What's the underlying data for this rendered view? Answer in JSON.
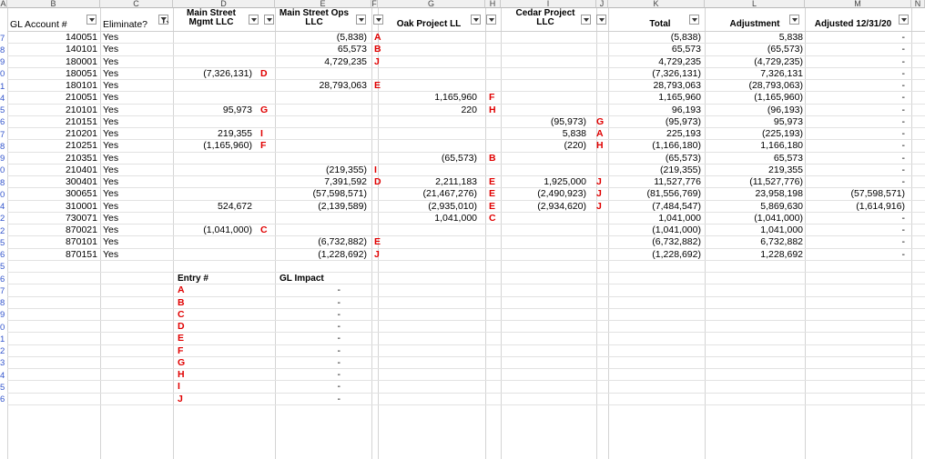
{
  "columns": [
    "A",
    "B",
    "C",
    "D",
    "E",
    "F",
    "G",
    "H",
    "I",
    "J",
    "K",
    "L",
    "M",
    "N"
  ],
  "row_numbers": [
    "7",
    "8",
    "9",
    "0",
    "1",
    "4",
    "5",
    "6",
    "7",
    "8",
    "9",
    "0",
    "8",
    "0",
    "4",
    "2",
    "2",
    "5",
    "6",
    "5",
    "6",
    "7",
    "8",
    "9",
    "0",
    "1",
    "2",
    "3",
    "4",
    "5",
    "6"
  ],
  "headers": {
    "gl_account": "GL Account #",
    "eliminate": "Eliminate?",
    "main_street_mgmt_1": "Main Street",
    "main_street_mgmt_2": "Mgmt LLC",
    "main_street_ops_1": "Main Street Ops",
    "main_street_ops_2": "LLC",
    "oak_project": "Oak Project LL",
    "cedar_project_1": "Cedar Project",
    "cedar_project_2": "LLC",
    "total": "Total",
    "adjustment": "Adjustment",
    "adjusted": "Adjusted 12/31/20"
  },
  "rows": [
    {
      "gl": "140051",
      "elim": "Yes",
      "c": "",
      "d": "",
      "e": "(5,838)",
      "f": "A",
      "g": "",
      "h": "",
      "i": "",
      "j": "",
      "total": "(5,838)",
      "adj": "5,838",
      "adjusted": "-"
    },
    {
      "gl": "140101",
      "elim": "Yes",
      "c": "",
      "d": "",
      "e": "65,573",
      "f": "B",
      "g": "",
      "h": "",
      "i": "",
      "j": "",
      "total": "65,573",
      "adj": "(65,573)",
      "adjusted": "-"
    },
    {
      "gl": "180001",
      "elim": "Yes",
      "c": "",
      "d": "",
      "e": "4,729,235",
      "f": "J",
      "g": "",
      "h": "",
      "i": "",
      "j": "",
      "total": "4,729,235",
      "adj": "(4,729,235)",
      "adjusted": "-"
    },
    {
      "gl": "180051",
      "elim": "Yes",
      "c": "(7,326,131)",
      "d": "D",
      "e": "",
      "f": "",
      "g": "",
      "h": "",
      "i": "",
      "j": "",
      "total": "(7,326,131)",
      "adj": "7,326,131",
      "adjusted": "-"
    },
    {
      "gl": "180101",
      "elim": "Yes",
      "c": "",
      "d": "",
      "e": "28,793,063",
      "f": "E",
      "g": "",
      "h": "",
      "i": "",
      "j": "",
      "total": "28,793,063",
      "adj": "(28,793,063)",
      "adjusted": "-"
    },
    {
      "gl": "210051",
      "elim": "Yes",
      "c": "",
      "d": "",
      "e": "",
      "f": "",
      "g": "1,165,960",
      "h": "F",
      "i": "",
      "j": "",
      "total": "1,165,960",
      "adj": "(1,165,960)",
      "adjusted": "-"
    },
    {
      "gl": "210101",
      "elim": "Yes",
      "c": "95,973",
      "d": "G",
      "e": "",
      "f": "",
      "g": "220",
      "h": "H",
      "i": "",
      "j": "",
      "total": "96,193",
      "adj": "(96,193)",
      "adjusted": "-"
    },
    {
      "gl": "210151",
      "elim": "Yes",
      "c": "",
      "d": "",
      "e": "",
      "f": "",
      "g": "",
      "h": "",
      "i": "(95,973)",
      "j": "G",
      "total": "(95,973)",
      "adj": "95,973",
      "adjusted": "-"
    },
    {
      "gl": "210201",
      "elim": "Yes",
      "c": "219,355",
      "d": "I",
      "e": "",
      "f": "",
      "g": "",
      "h": "",
      "i": "5,838",
      "j": "A",
      "total": "225,193",
      "adj": "(225,193)",
      "adjusted": "-"
    },
    {
      "gl": "210251",
      "elim": "Yes",
      "c": "(1,165,960)",
      "d": "F",
      "e": "",
      "f": "",
      "g": "",
      "h": "",
      "i": "(220)",
      "j": "H",
      "total": "(1,166,180)",
      "adj": "1,166,180",
      "adjusted": "-"
    },
    {
      "gl": "210351",
      "elim": "Yes",
      "c": "",
      "d": "",
      "e": "",
      "f": "",
      "g": "(65,573)",
      "h": "B",
      "i": "",
      "j": "",
      "total": "(65,573)",
      "adj": "65,573",
      "adjusted": "-"
    },
    {
      "gl": "210401",
      "elim": "Yes",
      "c": "",
      "d": "",
      "e": "(219,355)",
      "f": "I",
      "g": "",
      "h": "",
      "i": "",
      "j": "",
      "total": "(219,355)",
      "adj": "219,355",
      "adjusted": "-"
    },
    {
      "gl": "300401",
      "elim": "Yes",
      "c": "",
      "d": "",
      "e": "7,391,592",
      "f": "D",
      "g": "2,211,183",
      "h": "E",
      "i": "1,925,000",
      "j": "J",
      "total": "11,527,776",
      "adj": "(11,527,776)",
      "adjusted": "-"
    },
    {
      "gl": "300651",
      "elim": "Yes",
      "c": "",
      "d": "",
      "e": "(57,598,571)",
      "f": "",
      "g": "(21,467,276)",
      "h": "E",
      "i": "(2,490,923)",
      "j": "J",
      "total": "(81,556,769)",
      "adj": "23,958,198",
      "adjusted": "(57,598,571)"
    },
    {
      "gl": "310001",
      "elim": "Yes",
      "c": "524,672",
      "d": "",
      "e": "(2,139,589)",
      "f": "",
      "g": "(2,935,010)",
      "h": "E",
      "i": "(2,934,620)",
      "j": "J",
      "total": "(7,484,547)",
      "adj": "5,869,630",
      "adjusted": "(1,614,916)"
    },
    {
      "gl": "730071",
      "elim": "Yes",
      "c": "",
      "d": "",
      "e": "",
      "f": "",
      "g": "1,041,000",
      "h": "C",
      "i": "",
      "j": "",
      "total": "1,041,000",
      "adj": "(1,041,000)",
      "adjusted": "-"
    },
    {
      "gl": "870021",
      "elim": "Yes",
      "c": "(1,041,000)",
      "d": "C",
      "e": "",
      "f": "",
      "g": "",
      "h": "",
      "i": "",
      "j": "",
      "total": "(1,041,000)",
      "adj": "1,041,000",
      "adjusted": "-"
    },
    {
      "gl": "870101",
      "elim": "Yes",
      "c": "",
      "d": "",
      "e": "(6,732,882)",
      "f": "E",
      "g": "",
      "h": "",
      "i": "",
      "j": "",
      "total": "(6,732,882)",
      "adj": "6,732,882",
      "adjusted": "-"
    },
    {
      "gl": "870151",
      "elim": "Yes",
      "c": "",
      "d": "",
      "e": "(1,228,692)",
      "f": "J",
      "g": "",
      "h": "",
      "i": "",
      "j": "",
      "total": "(1,228,692)",
      "adj": "1,228,692",
      "adjusted": "-"
    }
  ],
  "entry_table": {
    "entry_header": "Entry #",
    "impact_header": "GL Impact",
    "entries": [
      {
        "id": "A",
        "impact": "-"
      },
      {
        "id": "B",
        "impact": "-"
      },
      {
        "id": "C",
        "impact": "-"
      },
      {
        "id": "D",
        "impact": "-"
      },
      {
        "id": "E",
        "impact": "-"
      },
      {
        "id": "F",
        "impact": "-"
      },
      {
        "id": "G",
        "impact": "-"
      },
      {
        "id": "H",
        "impact": "-"
      },
      {
        "id": "I",
        "impact": "-"
      },
      {
        "id": "J",
        "impact": "-"
      }
    ]
  },
  "colors": {
    "ref_letter": "#e00000",
    "row_number": "#3355cc"
  },
  "icons": {
    "filter_dropdown": "dropdown-arrow-icon",
    "active_filter": "funnel-filter-icon"
  }
}
